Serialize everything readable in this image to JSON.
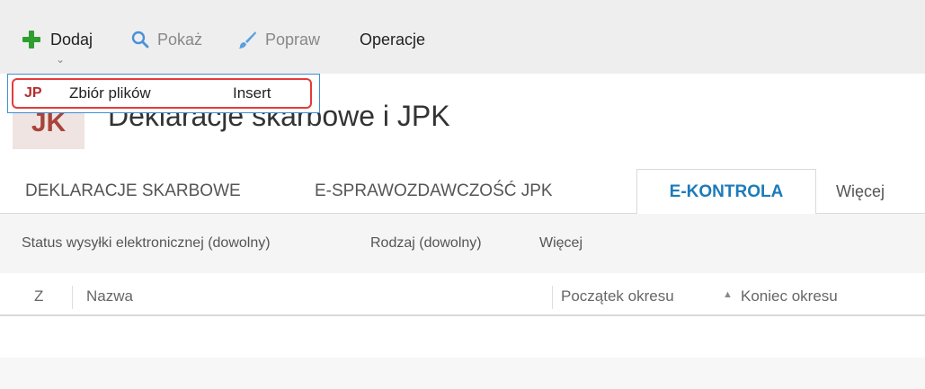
{
  "toolbar": {
    "add_label": "Dodaj",
    "show_label": "Pokaż",
    "fix_label": "Popraw",
    "operations_label": "Operacje",
    "caret": "⌄"
  },
  "dropdown": {
    "item": {
      "prefix": "JP",
      "label": "Zbiór plików",
      "shortcut": "Insert"
    }
  },
  "module": {
    "icon_text": "JK",
    "title": "Deklaracje skarbowe i JPK"
  },
  "tabs": [
    {
      "label": "DEKLARACJE SKARBOWE",
      "active": false
    },
    {
      "label": "E-SPRAWOZDAWCZOŚĆ JPK",
      "active": false
    },
    {
      "label": "E-KONTROLA",
      "active": true
    },
    {
      "label": "Więcej",
      "active": false
    }
  ],
  "filters": [
    "Status wysyłki elektronicznej (dowolny)",
    "Rodzaj (dowolny)",
    "Więcej"
  ],
  "grid": {
    "columns": [
      "Z",
      "Nazwa",
      "Początek okresu",
      "Koniec okresu"
    ],
    "sort_indicator": "▲"
  },
  "colors": {
    "accent": "#1c7bb8",
    "add_green": "#2e9e2e",
    "highlight_red": "#e33b3b",
    "module_red": "#a8443b"
  }
}
